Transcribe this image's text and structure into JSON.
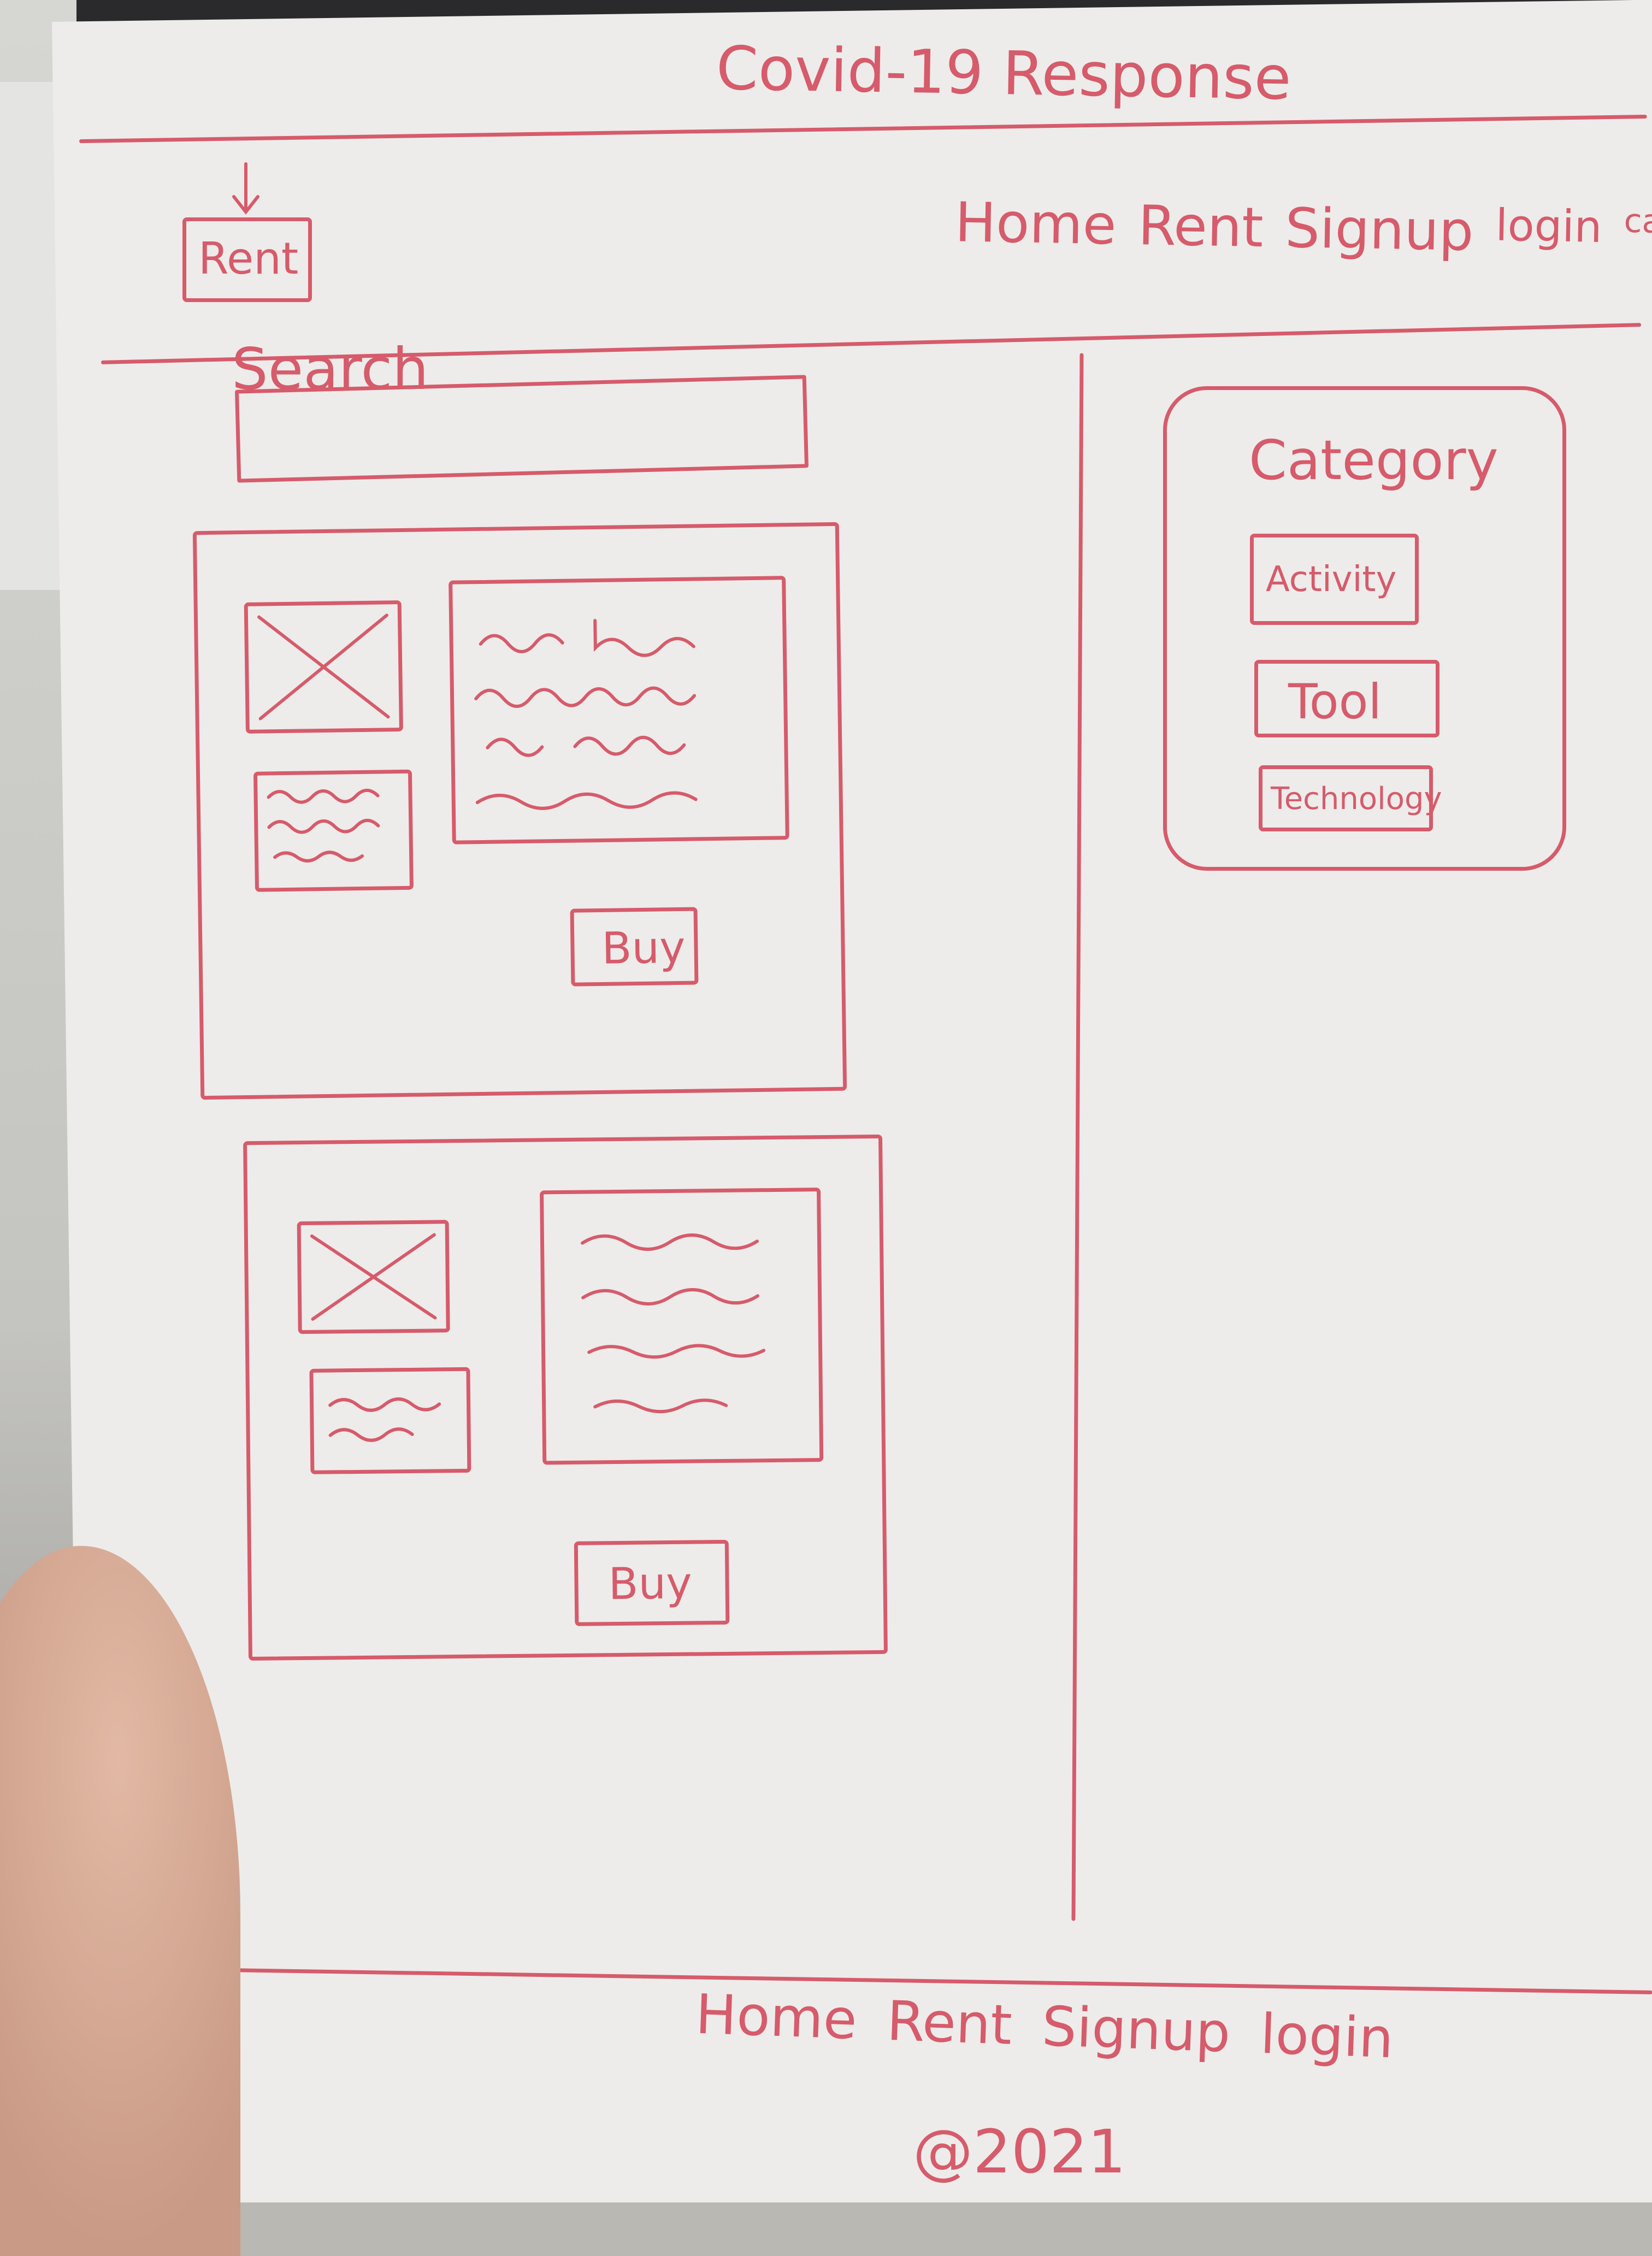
{
  "header": {
    "title": "Covid-19 Response",
    "logo_label": "Rent",
    "nav": [
      "Home",
      "Rent",
      "Signup",
      "login",
      "cart"
    ]
  },
  "search": {
    "label": "Search",
    "placeholder": ""
  },
  "products": [
    {
      "image": "image-placeholder",
      "buy_label": "Buy"
    },
    {
      "image": "image-placeholder",
      "buy_label": "Buy"
    }
  ],
  "category": {
    "title": "Category",
    "items": [
      "Activity",
      "Tool",
      "Technology"
    ]
  },
  "footer": {
    "nav": [
      "Home",
      "Rent",
      "Signup",
      "login"
    ],
    "copyright": "@2021"
  },
  "colors": {
    "ink": "#d65b6b",
    "paper": "#edecea"
  }
}
